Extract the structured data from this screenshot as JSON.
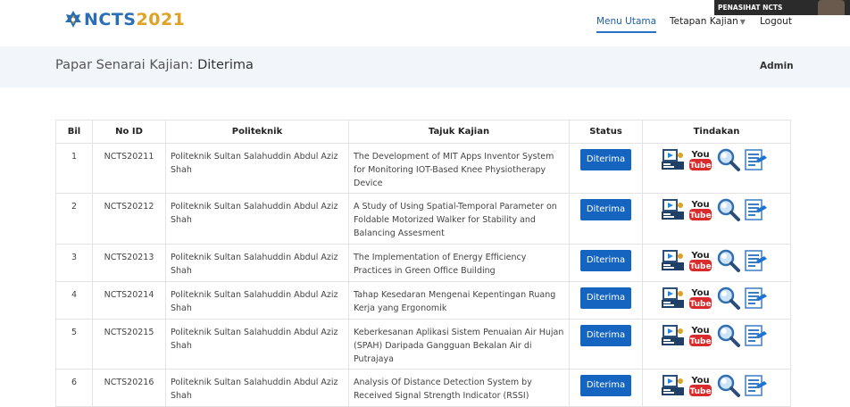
{
  "brand": {
    "ncts": "NCTS",
    "year": "2021"
  },
  "nav": {
    "menu_utama": "Menu Utama",
    "tetapan_kajian": "Tetapan Kajian",
    "logout": "Logout"
  },
  "video": {
    "label": "PENASIHAT NCTS"
  },
  "subheader": {
    "title_prefix": "Papar Senarai Kajian:",
    "title_status": "Diterima",
    "user": "Admin"
  },
  "table": {
    "headers": {
      "bil": "Bil",
      "no_id": "No ID",
      "politeknik": "Politeknik",
      "tajuk": "Tajuk Kajian",
      "status": "Status",
      "tindakan": "Tindakan"
    },
    "rows": [
      {
        "bil": "1",
        "id": "NCTS20211",
        "politeknik": "Politeknik Sultan Salahuddin Abdul Aziz Shah",
        "tajuk": "The Development of MIT Apps Inventor System for Monitoring IOT-Based Knee Physiotherapy Device",
        "status": "Diterima"
      },
      {
        "bil": "2",
        "id": "NCTS20212",
        "politeknik": "Politeknik Sultan Salahuddin Abdul Aziz Shah",
        "tajuk": "A Study of Using Spatial-Temporal Parameter on Foldable Motorized Walker for Stability and Balancing Assesment",
        "status": "Diterima"
      },
      {
        "bil": "3",
        "id": "NCTS20213",
        "politeknik": "Politeknik Sultan Salahuddin Abdul Aziz Shah",
        "tajuk": "The Implementation of Energy Efficiency Practices in Green Office Building",
        "status": "Diterima"
      },
      {
        "bil": "4",
        "id": "NCTS20214",
        "politeknik": "Politeknik Sultan Salahuddin Abdul Aziz Shah",
        "tajuk": "Tahap Kesedaran Mengenai Kepentingan Ruang Kerja yang Ergonomik",
        "status": "Diterima"
      },
      {
        "bil": "5",
        "id": "NCTS20215",
        "politeknik": "Politeknik Sultan Salahuddin Abdul Aziz Shah",
        "tajuk": "Keberkesanan Aplikasi Sistem Penuaian Air Hujan (SPAH) Daripada Gangguan Bekalan Air di Putrajaya",
        "status": "Diterima"
      },
      {
        "bil": "6",
        "id": "NCTS20216",
        "politeknik": "Politeknik Sultan Salahuddin Abdul Aziz Shah",
        "tajuk": "Analysis Of Distance Detection System by Received Signal Strength Indicator (RSSI)",
        "status": "Diterima"
      }
    ]
  },
  "icons": {
    "you": "You",
    "tube": "Tube"
  },
  "colors": {
    "primary": "#1565c0",
    "subheader_bg": "#f2f5fa",
    "youtube_red": "#d92b2b"
  }
}
